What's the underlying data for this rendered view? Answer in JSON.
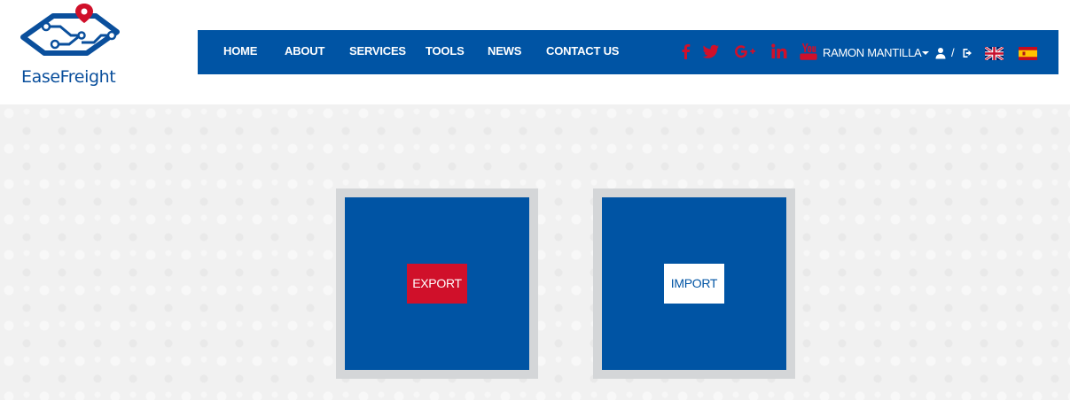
{
  "brand": {
    "name": "EaseFreight",
    "color": "#0a4f9c",
    "pin_color": "#d0102a"
  },
  "nav": {
    "items": [
      {
        "label": "HOME"
      },
      {
        "label": "ABOUT"
      },
      {
        "label": "SERVICES"
      },
      {
        "label": "TOOLS"
      },
      {
        "label": "NEWS"
      },
      {
        "label": "CONTACT US"
      }
    ],
    "background": "#0054a4"
  },
  "social": [
    "facebook-icon",
    "twitter-icon",
    "google-plus-icon",
    "linkedin-icon",
    "youtube-icon"
  ],
  "social_color": "#d0102a",
  "user": {
    "name": "RAMON MANTILLA",
    "separator": "/"
  },
  "languages": [
    "English",
    "Español"
  ],
  "main": {
    "export_label": "EXPORT",
    "import_label": "IMPORT",
    "export_color": "#d0102a",
    "card_color": "#0054a4"
  }
}
